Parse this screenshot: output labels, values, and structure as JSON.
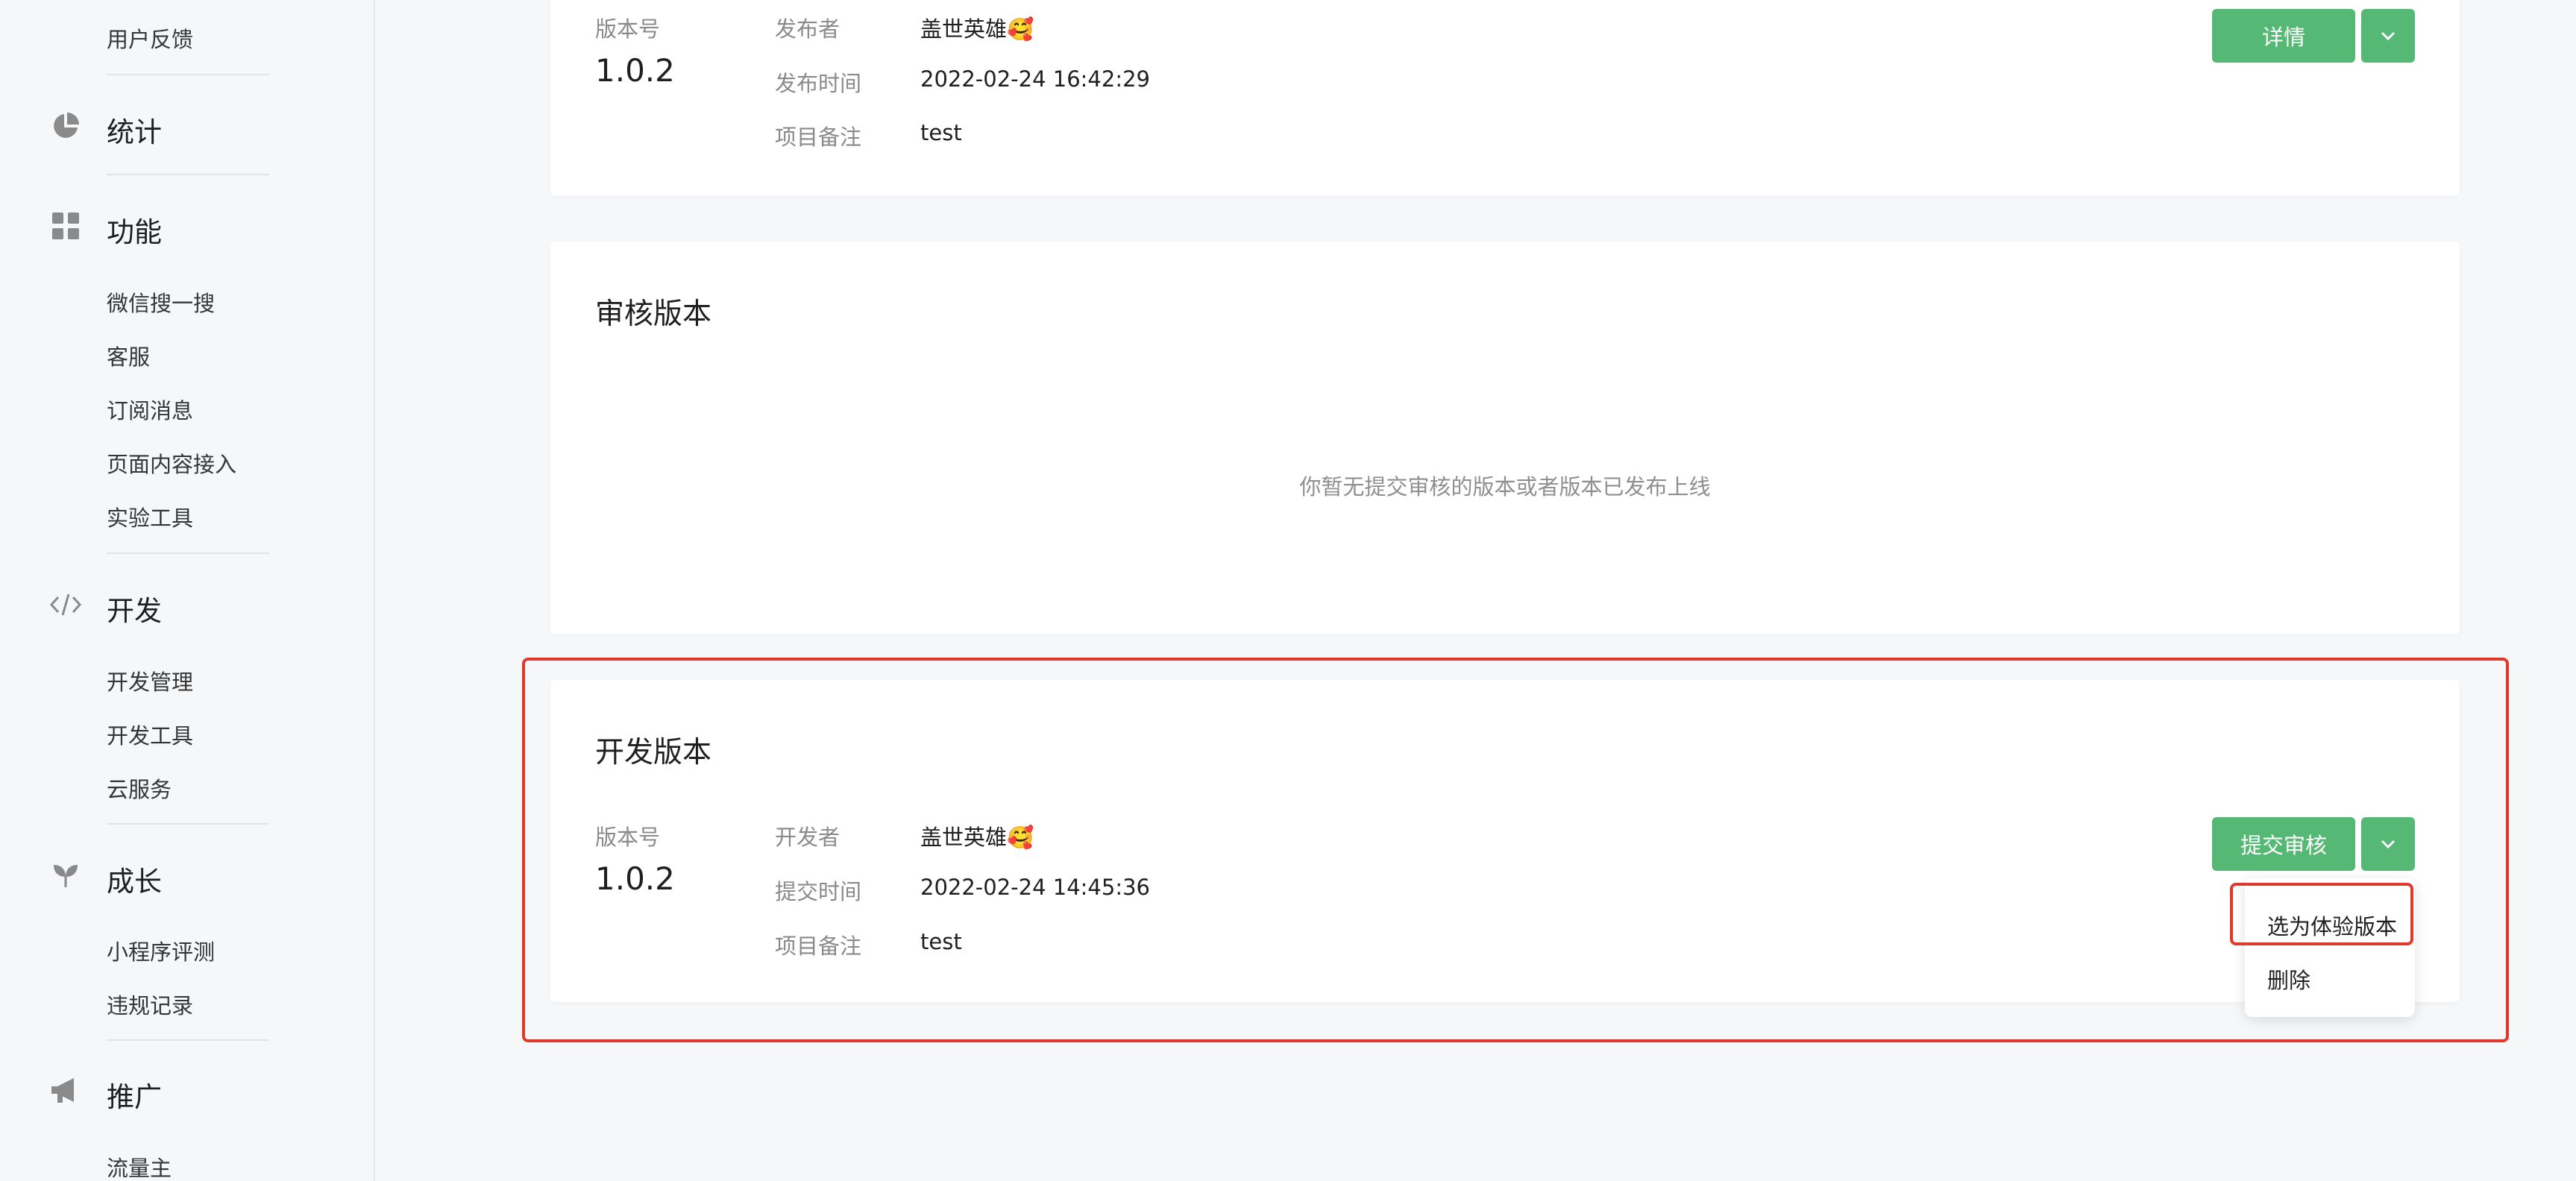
{
  "sidebar": {
    "top_item": "用户反馈",
    "sections": [
      {
        "title": "统计",
        "icon": "pie-chart-icon",
        "items": []
      },
      {
        "title": "功能",
        "icon": "grid-icon",
        "items": [
          "微信搜一搜",
          "客服",
          "订阅消息",
          "页面内容接入",
          "实验工具"
        ]
      },
      {
        "title": "开发",
        "icon": "code-icon",
        "items": [
          "开发管理",
          "开发工具",
          "云服务"
        ]
      },
      {
        "title": "成长",
        "icon": "sprout-icon",
        "items": [
          "小程序评测",
          "违规记录"
        ]
      },
      {
        "title": "推广",
        "icon": "megaphone-icon",
        "items": [
          "流量主"
        ]
      }
    ]
  },
  "release": {
    "version_label": "版本号",
    "version": "1.0.2",
    "publisher_label": "发布者",
    "publisher": "盖世英雄🥰",
    "time_label": "发布时间",
    "time": "2022-02-24 16:42:29",
    "note_label": "项目备注",
    "note": "test",
    "detail_button": "详情"
  },
  "review": {
    "title": "审核版本",
    "empty_text": "你暂无提交审核的版本或者版本已发布上线"
  },
  "dev": {
    "title": "开发版本",
    "version_label": "版本号",
    "version": "1.0.2",
    "developer_label": "开发者",
    "developer": "盖世英雄🥰",
    "time_label": "提交时间",
    "time": "2022-02-24 14:45:36",
    "note_label": "项目备注",
    "note": "test",
    "submit_button": "提交审核",
    "menu": {
      "items": [
        "选为体验版本",
        "删除"
      ]
    }
  },
  "colors": {
    "accent_green": "#55b874",
    "highlight_red": "#e0392b"
  }
}
